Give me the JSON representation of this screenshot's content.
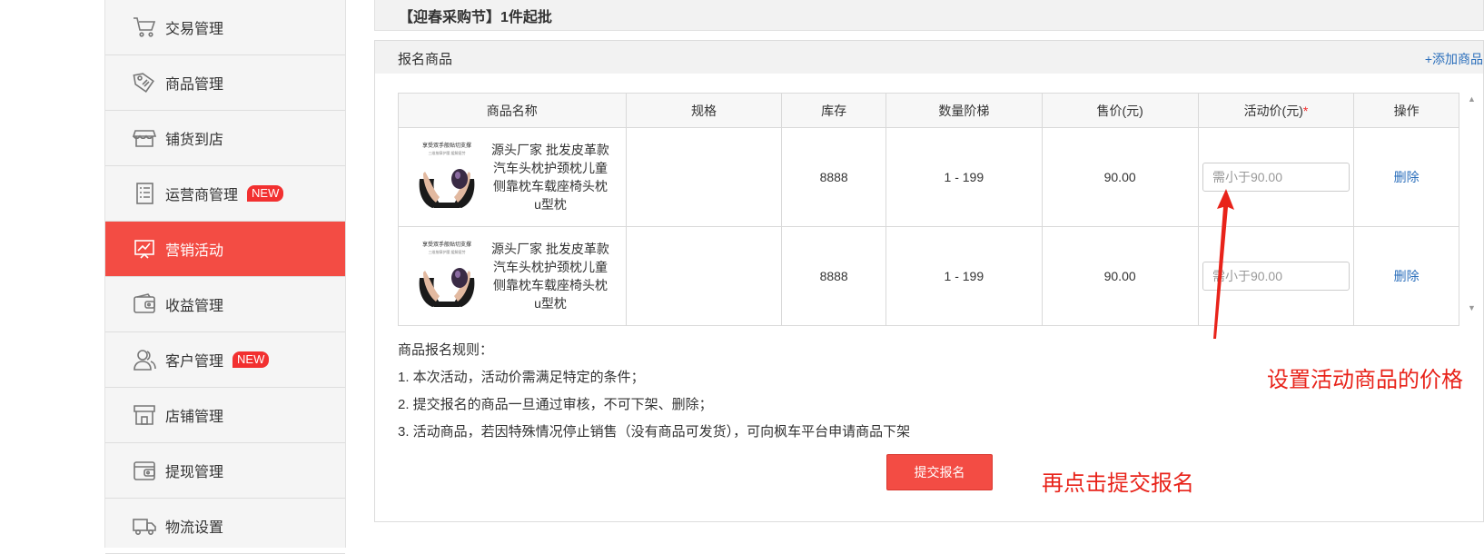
{
  "sidebar": {
    "items": [
      {
        "label": "交易管理",
        "icon": "cart-icon"
      },
      {
        "label": "商品管理",
        "icon": "tag-icon"
      },
      {
        "label": "铺货到店",
        "icon": "store-icon"
      },
      {
        "label": "运营商管理",
        "icon": "document-list-icon",
        "badge": "NEW"
      },
      {
        "label": "营销活动",
        "icon": "chart-board-icon",
        "active": true
      },
      {
        "label": "收益管理",
        "icon": "wallet-icon"
      },
      {
        "label": "客户管理",
        "icon": "users-icon",
        "badge": "NEW"
      },
      {
        "label": "店铺管理",
        "icon": "shop-icon"
      },
      {
        "label": "提现管理",
        "icon": "withdraw-wallet-icon"
      },
      {
        "label": "物流设置",
        "icon": "truck-icon"
      }
    ]
  },
  "page": {
    "title": "【迎春采购节】1件起批"
  },
  "panel": {
    "title": "报名商品",
    "add_label": "+添加商品",
    "columns": [
      "商品名称",
      "规格",
      "库存",
      "数量阶梯",
      "售价(元)",
      "活动价(元)",
      "操作"
    ],
    "required_mark": "*",
    "rows": [
      {
        "image_caption": "享受双手般贴切支撑",
        "image_subcaption": "三维按摩护腰 缓解疲劳",
        "name": "源头厂家 批发皮革款汽车头枕护颈枕儿童侧靠枕车载座椅头枕u型枕",
        "spec": "",
        "stock": "8888",
        "qty_range": "1 - 199",
        "price": "90.00",
        "activity_price_value": "",
        "activity_price_placeholder": "需小于90.00",
        "action": "删除"
      },
      {
        "image_caption": "享受双手般贴切支撑",
        "image_subcaption": "三维按摩护腰 缓解疲劳",
        "name": "源头厂家 批发皮革款汽车头枕护颈枕儿童侧靠枕车载座椅头枕u型枕",
        "spec": "",
        "stock": "8888",
        "qty_range": "1 - 199",
        "price": "90.00",
        "activity_price_value": "",
        "activity_price_placeholder": "需小于90.00",
        "action": "删除"
      }
    ],
    "rules": {
      "heading": "商品报名规则：",
      "items": [
        "1. 本次活动，活动价需满足特定的条件；",
        "2. 提交报名的商品一旦通过审核，不可下架、删除；",
        "3. 活动商品，若因特殊情况停止销售（没有商品可发货），可向枫车平台申请商品下架"
      ]
    },
    "submit_label": "提交报名"
  },
  "annotations": {
    "set_price": "设置活动商品的价格",
    "click_submit": "再点击提交报名",
    "color": "#e8231a"
  },
  "colors": {
    "accent": "#f34c44",
    "link": "#2a6ebb",
    "badge": "#f23030"
  }
}
